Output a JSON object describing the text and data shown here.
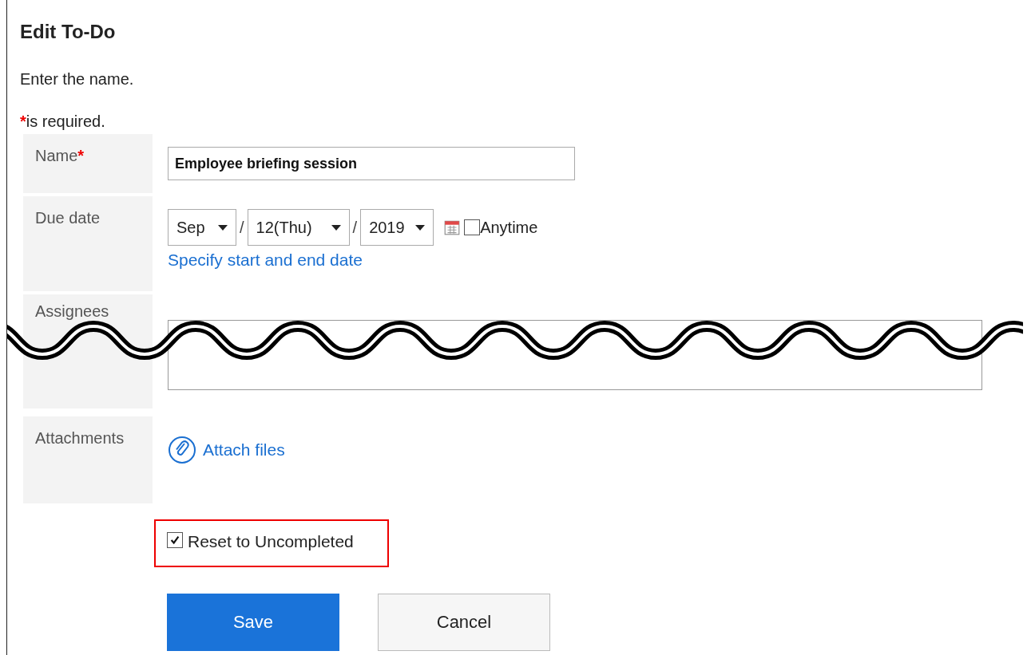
{
  "title": "Edit To-Do",
  "instruction": "Enter the name.",
  "required_note": {
    "mark": "*",
    "text": "is required."
  },
  "fields": [
    {
      "kind": "text",
      "label": "Name",
      "required": true,
      "value": "Employee briefing session"
    },
    {
      "kind": "date",
      "label": "Due date",
      "required": false,
      "month": "Sep",
      "day": "12(Thu)",
      "year": "2019",
      "separator": "/",
      "anytime": {
        "label": "Anytime",
        "checked": false
      },
      "link": "Specify start and end date"
    },
    {
      "kind": "assignees",
      "label": "Assignees",
      "required": false
    },
    {
      "kind": "attach",
      "label": "Attachments",
      "required": false,
      "link": "Attach files"
    }
  ],
  "reset": {
    "label": "Reset to Uncompleted",
    "checked": true
  },
  "buttons": [
    {
      "label": "Save",
      "primary": true
    },
    {
      "label": "Cancel",
      "primary": false
    }
  ]
}
